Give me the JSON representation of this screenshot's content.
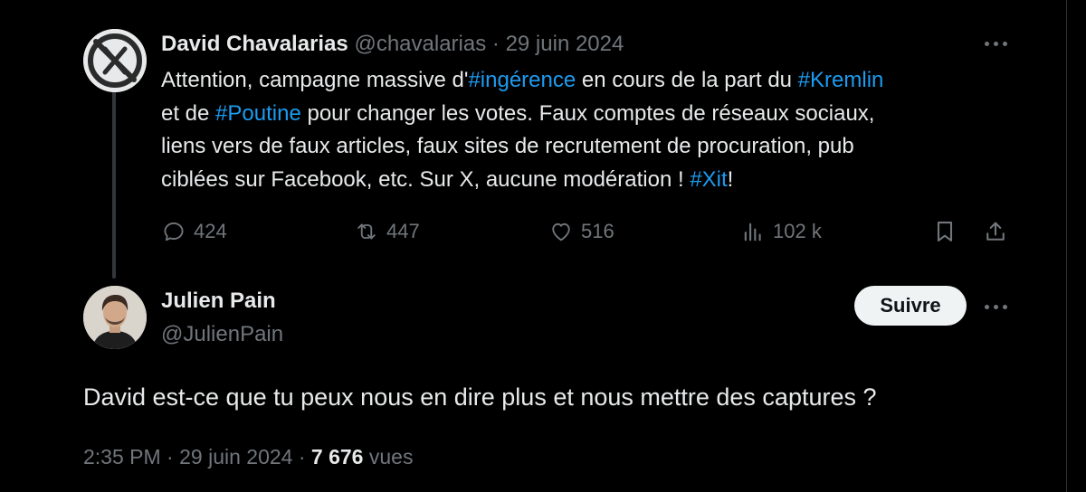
{
  "original_tweet": {
    "author_name": "David Chavalarias",
    "handle": "@chavalarias",
    "separator": "·",
    "date": "29 juin 2024",
    "text_lines": [
      [
        {
          "t": "Attention, campagne massive d'"
        },
        {
          "t": "#ingérence",
          "tag": true
        },
        {
          "t": " en cours de la part du "
        },
        {
          "t": "#Kremlin",
          "tag": true
        }
      ],
      [
        {
          "t": "et de "
        },
        {
          "t": "#Poutine",
          "tag": true
        },
        {
          "t": " pour changer les votes. Faux comptes de réseaux sociaux,"
        }
      ],
      [
        {
          "t": "liens vers de faux articles, faux sites de recrutement de procuration, pub"
        }
      ],
      [
        {
          "t": "ciblées sur Facebook, etc. Sur X, aucune modération !  "
        },
        {
          "t": "#Xit",
          "tag": true
        },
        {
          "t": "!"
        }
      ]
    ],
    "actions": {
      "replies": "424",
      "reposts": "447",
      "likes": "516",
      "views": "102 k"
    }
  },
  "reply_tweet": {
    "author_name": "Julien Pain",
    "handle": "@JulienPain",
    "follow_label": "Suivre",
    "text": "David est-ce que tu peux nous en dire plus et nous mettre des captures ?",
    "time": "2:35 PM",
    "separator": "·",
    "date": "29 juin 2024",
    "views_count": "7 676",
    "views_label": "vues"
  },
  "colors": {
    "background": "#000000",
    "text": "#e7e9ea",
    "secondary": "#71767b",
    "link": "#1d9bf0",
    "button_bg": "#eff3f4"
  }
}
